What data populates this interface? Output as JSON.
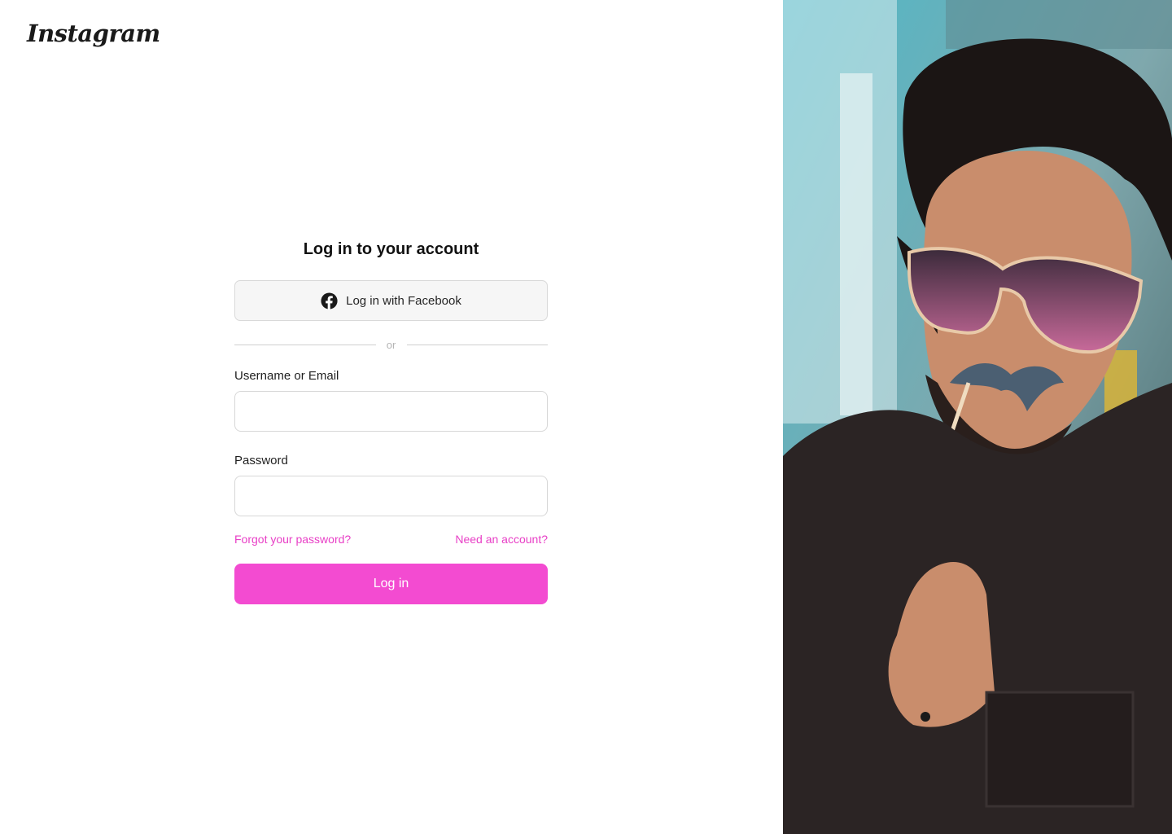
{
  "brand": {
    "logo_text": "Instagram"
  },
  "login": {
    "title": "Log in to your account",
    "facebook_button_label": "Log in with Facebook",
    "facebook_icon": "facebook-icon",
    "divider_text": "or",
    "username_label": "Username or Email",
    "username_value": "",
    "password_label": "Password",
    "password_value": "",
    "forgot_password_link": "Forgot your password?",
    "need_account_link": "Need an account?",
    "submit_label": "Log in"
  },
  "colors": {
    "accent": "#f34bd1",
    "link": "#e83fc6",
    "facebook_button_bg": "#f6f6f6",
    "input_border": "#d7d7d7"
  },
  "hero_image": {
    "subject": "man in sunglasses holding a paper mustache prop"
  }
}
